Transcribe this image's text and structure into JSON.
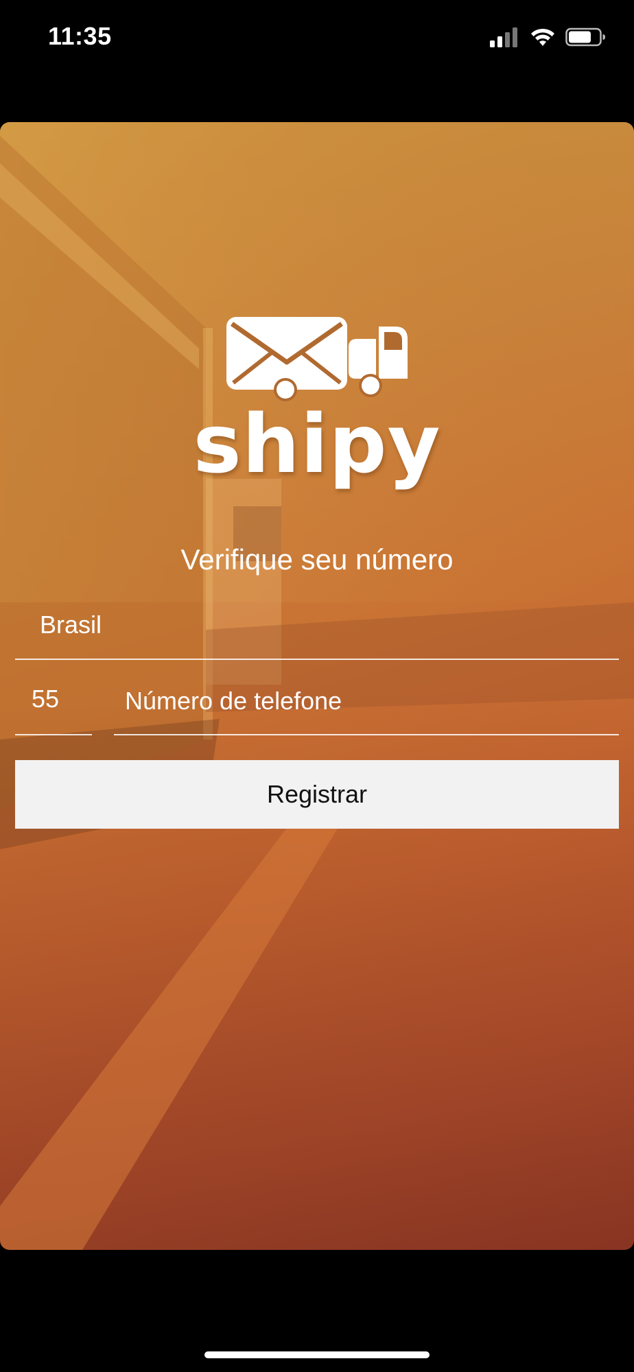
{
  "status_bar": {
    "time": "11:35",
    "signal_icon": "cellular-signal-icon",
    "wifi_icon": "wifi-icon",
    "battery_icon": "battery-icon",
    "battery_level": 0.7
  },
  "brand": {
    "logo_icon": "envelope-truck-logo-icon",
    "name": "shipy"
  },
  "form": {
    "title": "Verifique seu número",
    "country": "Brasil",
    "country_code": "55",
    "phone_placeholder": "Número de telefone",
    "phone_value": "",
    "register_label": "Registrar"
  },
  "colors": {
    "background_top": "#c9933f",
    "background_bottom": "#983a27",
    "button_bg": "#f2f2f2",
    "text": "#ffffff"
  }
}
